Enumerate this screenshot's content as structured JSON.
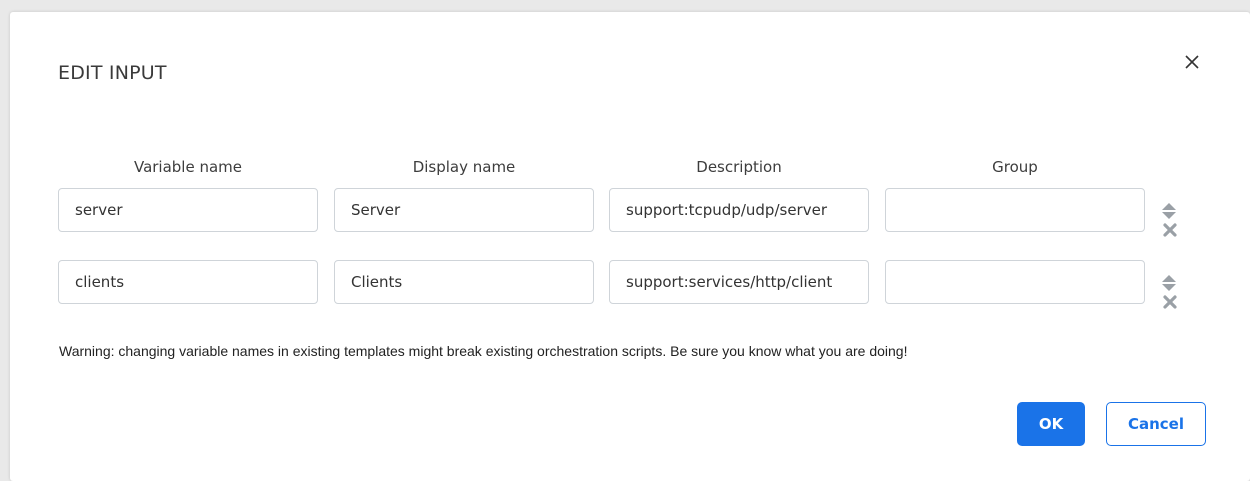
{
  "dialog": {
    "title": "EDIT INPUT",
    "close_icon": "close-icon"
  },
  "columns": {
    "variable_name": "Variable name",
    "display_name": "Display name",
    "description": "Description",
    "group": "Group"
  },
  "rows": [
    {
      "variable_name": "server",
      "display_name": "Server",
      "description": "support:tcpudp/udp/server",
      "group": ""
    },
    {
      "variable_name": "clients",
      "display_name": "Clients",
      "description": "support:services/http/client",
      "group": ""
    }
  ],
  "row_controls": {
    "sort_icon": "sort-icon",
    "remove_icon": "remove-icon"
  },
  "warning": "Warning: changing variable names in existing templates might break existing orchestration scripts. Be sure you know what you are doing!",
  "buttons": {
    "ok": "OK",
    "cancel": "Cancel"
  },
  "colors": {
    "primary": "#1a73e8",
    "icon_gray": "#9aa0a6"
  }
}
